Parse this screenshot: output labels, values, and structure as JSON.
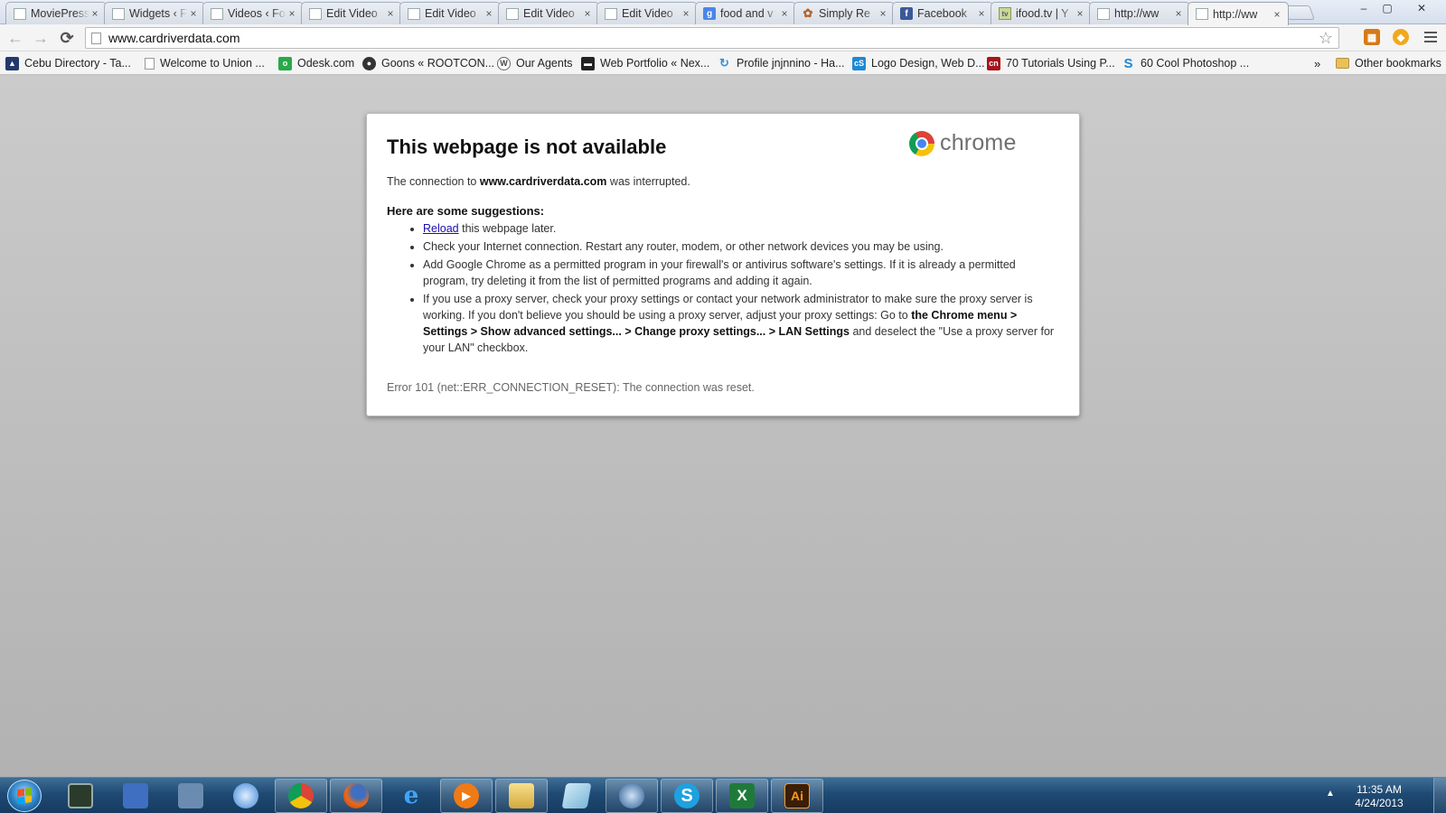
{
  "tabs": [
    {
      "title": "MoviePress",
      "icon": "page-icon"
    },
    {
      "title": "Widgets ‹ F",
      "icon": "page-icon"
    },
    {
      "title": "Videos ‹ Fo",
      "icon": "page-icon"
    },
    {
      "title": "Edit Video",
      "icon": "page-icon"
    },
    {
      "title": "Edit Video",
      "icon": "page-icon"
    },
    {
      "title": "Edit Video",
      "icon": "page-icon"
    },
    {
      "title": "Edit Video",
      "icon": "page-icon"
    },
    {
      "title": "food and v",
      "icon": "google-icon"
    },
    {
      "title": "Simply Re",
      "icon": "flower-icon"
    },
    {
      "title": "Facebook",
      "icon": "facebook-icon"
    },
    {
      "title": "ifood.tv | Y",
      "icon": "ifood-icon"
    },
    {
      "title": "http://ww",
      "icon": "page-icon"
    },
    {
      "title": "http://ww",
      "icon": "page-icon",
      "active": true
    }
  ],
  "tab_close_glyph": "×",
  "window_controls": {
    "minimize": "–",
    "maximize": "▢",
    "close": "✕"
  },
  "toolbar": {
    "back_glyph": "←",
    "forward_glyph": "→",
    "reload_glyph": "⟳",
    "url": "www.cardriverdata.com",
    "star_glyph": "☆"
  },
  "bookmarks": [
    {
      "label": "Cebu Directory - Ta...",
      "icon": "cebu-icon"
    },
    {
      "label": "Welcome to Union ...",
      "icon": "page-icon"
    },
    {
      "label": "Odesk.com",
      "icon": "odesk-icon"
    },
    {
      "label": "Goons « ROOTCON...",
      "icon": "goons-icon"
    },
    {
      "label": "Our Agents",
      "icon": "wordpress-icon"
    },
    {
      "label": "Web Portfolio « Nex...",
      "icon": "portfolio-icon"
    },
    {
      "label": "Profile jnjnnino - Ha...",
      "icon": "refresh-icon"
    },
    {
      "label": "Logo Design, Web D...",
      "icon": "cs-icon"
    },
    {
      "label": "70 Tutorials Using P...",
      "icon": "cn-icon"
    },
    {
      "label": "60 Cool Photoshop ...",
      "icon": "s-icon"
    }
  ],
  "bookmarks_overflow": "»",
  "other_bookmarks": "Other bookmarks",
  "error": {
    "title": "This webpage is not available",
    "logo_text": "chrome",
    "summary_prefix": "The connection to ",
    "summary_host": "www.cardriverdata.com",
    "summary_suffix": " was interrupted.",
    "suggestions_heading": "Here are some suggestions:",
    "reload_link": "Reload",
    "reload_rest": " this webpage later.",
    "s2": "Check your Internet connection. Restart any router, modem, or other network devices you may be using.",
    "s3": "Add Google Chrome as a permitted program in your firewall's or antivirus software's settings. If it is already a permitted program, try deleting it from the list of permitted programs and adding it again.",
    "s4_a": "If you use a proxy server, check your proxy settings or contact your network administrator to make sure the proxy server is working. If you don't believe you should be using a proxy server, adjust your proxy settings: Go to ",
    "s4_b": "the Chrome menu > Settings > Show advanced settings... > Change proxy settings... > LAN Settings",
    "s4_c": " and deselect the \"Use a proxy server for your LAN\" checkbox.",
    "code": "Error 101 (net::ERR_CONNECTION_RESET): The connection was reset."
  },
  "taskbar": {
    "apps": [
      {
        "name": "terminal-icon",
        "label": ""
      },
      {
        "name": "network-icon",
        "label": ""
      },
      {
        "name": "devices-icon",
        "label": ""
      },
      {
        "name": "safari-icon",
        "label": ""
      },
      {
        "name": "chrome-icon",
        "label": ""
      },
      {
        "name": "firefox-icon",
        "label": ""
      },
      {
        "name": "ie-icon",
        "label": "e"
      },
      {
        "name": "media-icon",
        "label": "▶"
      },
      {
        "name": "explorer-icon",
        "label": ""
      },
      {
        "name": "notes-icon",
        "label": ""
      },
      {
        "name": "thunderbird-icon",
        "label": ""
      },
      {
        "name": "skype-icon",
        "label": "S"
      },
      {
        "name": "excel-icon",
        "label": "X"
      },
      {
        "name": "illustrator-icon",
        "label": "Ai"
      }
    ],
    "tray_arrow": "▲",
    "time": "11:35 AM",
    "date": "4/24/2013"
  },
  "colors": {
    "link": "#1a0dab",
    "taskbar": "#1f4a73"
  }
}
